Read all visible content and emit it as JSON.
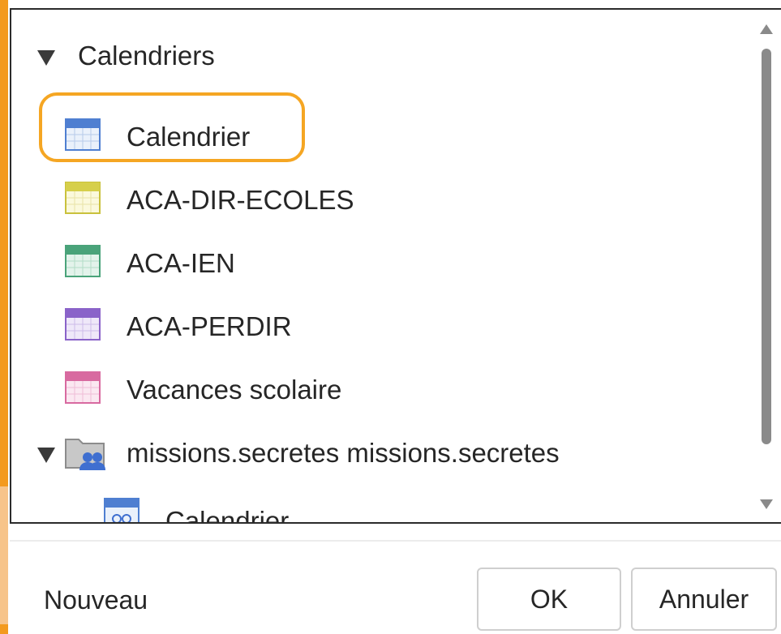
{
  "tree": {
    "groups": [
      {
        "label": "Calendriers",
        "expanded": true,
        "items": [
          {
            "label": "Calendrier",
            "color": "#4f7fd1",
            "highlighted": true
          },
          {
            "label": "ACA-DIR-ECOLES",
            "color": "#d6cf4a"
          },
          {
            "label": "ACA-IEN",
            "color": "#4aa37a"
          },
          {
            "label": "ACA-PERDIR",
            "color": "#8a63c9"
          },
          {
            "label": "Vacances scolaire",
            "color": "#d86aa0"
          }
        ]
      },
      {
        "label": "missions.secretes missions.secretes",
        "expanded": true,
        "icon": "shared-folder-icon",
        "items": [
          {
            "label": "Calendrier",
            "icon": "shared-calendar-icon",
            "color": "#4f7fd1"
          }
        ]
      }
    ]
  },
  "highlight_color": "#f5a623",
  "footer": {
    "new_label": "Nouveau",
    "ok_label": "OK",
    "cancel_label": "Annuler"
  }
}
